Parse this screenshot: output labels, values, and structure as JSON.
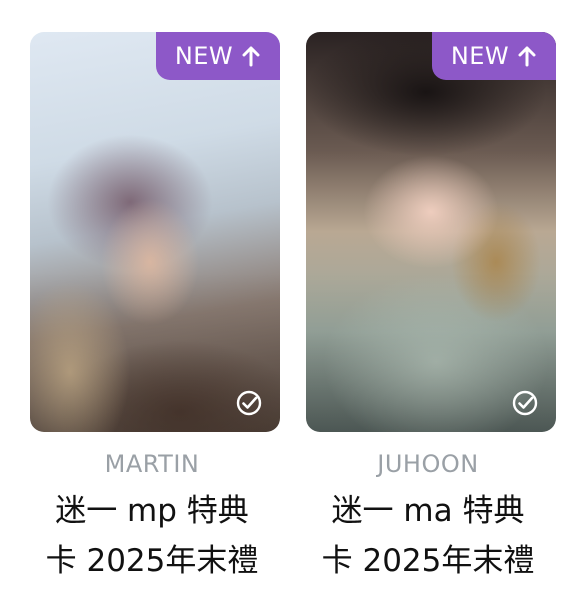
{
  "cards": [
    {
      "badge": "NEW",
      "badge_icon": "arrow-up-icon",
      "check_icon": "check-circle-icon",
      "member": "MARTIN",
      "title_line1": "迷一 mp 特典",
      "title_line2": "卡 2025年末禮"
    },
    {
      "badge": "NEW",
      "badge_icon": "arrow-up-icon",
      "check_icon": "check-circle-icon",
      "member": "JUHOON",
      "title_line1": "迷一 ma 特典",
      "title_line2": "卡 2025年末禮"
    }
  ],
  "colors": {
    "badge_bg": "#8d58c8",
    "member_text": "#9aa0a6",
    "title_text": "#111111"
  }
}
